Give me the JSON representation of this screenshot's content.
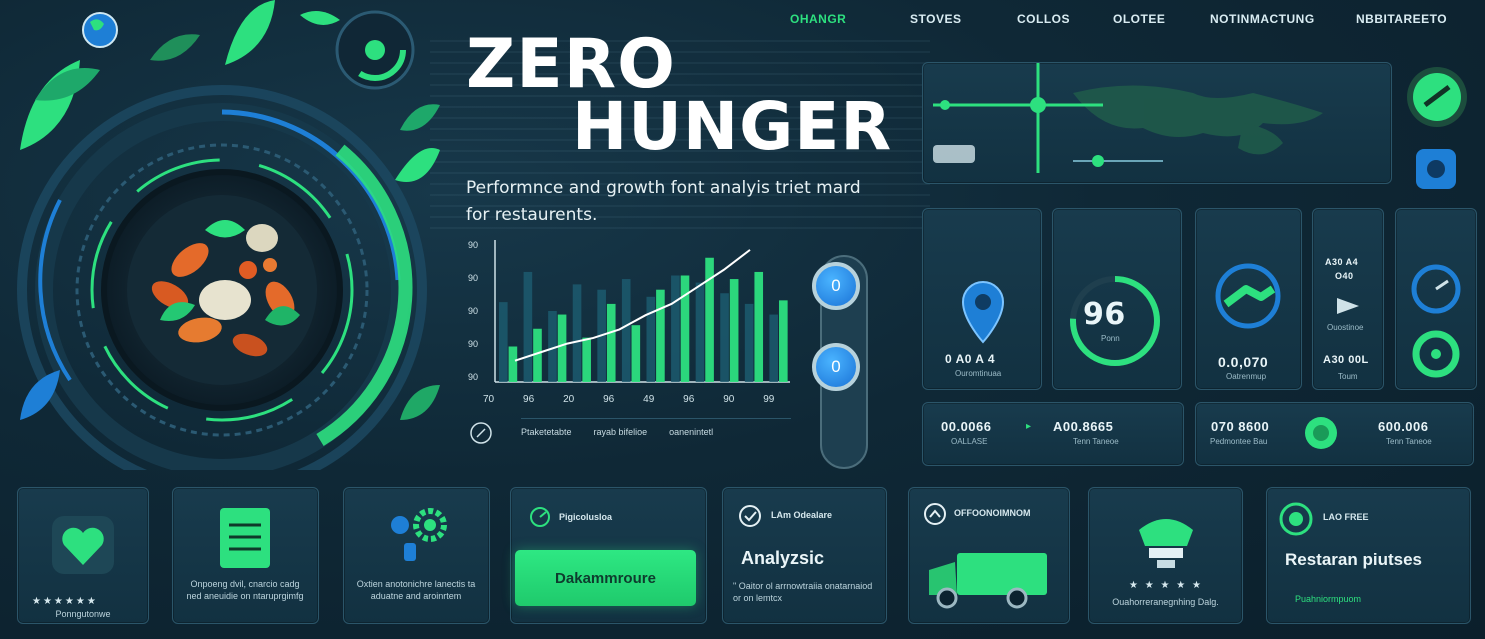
{
  "nav": {
    "items": [
      {
        "label": "OHANGR",
        "active": true
      },
      {
        "label": "STOVES",
        "active": false
      },
      {
        "label": "COLLOS",
        "active": false
      },
      {
        "label": "OLOTEE",
        "active": false
      },
      {
        "label": "NOTINMACTUNG",
        "active": false
      },
      {
        "label": "NBBITAREETO",
        "active": false
      }
    ]
  },
  "hero": {
    "title_line1": "ZERO",
    "title_line2": "HUNGER",
    "subtitle": "Performnce and growth font analyis triet mard for restaurents."
  },
  "chart_data": {
    "type": "bar",
    "y_ticks": [
      "90",
      "90",
      "90",
      "90",
      "90"
    ],
    "x_ticks": [
      "70",
      "96",
      "20",
      "96",
      "49",
      "96",
      "90",
      "99"
    ],
    "series": [
      {
        "values": [
          45,
          62,
          40,
          55,
          52,
          58,
          48,
          60,
          56,
          50,
          44,
          38
        ]
      },
      {
        "values": [
          20,
          30,
          38,
          25,
          44,
          32,
          52,
          60,
          70,
          58,
          62,
          46
        ]
      }
    ],
    "trend": [
      8,
      14,
      20,
      24,
      30,
      40,
      48,
      60,
      72,
      86
    ],
    "legend": [
      "Ptaketetabte",
      "rayab bifelioe",
      "oanenintetl"
    ]
  },
  "toggles": {
    "top_value": "0",
    "bottom_value": "0"
  },
  "kpi_tiles": [
    {
      "value": "0 A0 A 4",
      "label": "Ouromtinuaa"
    },
    {
      "value": "96",
      "label": "Ponn"
    },
    {
      "value": "0.0,070",
      "label": "Oatrenmup"
    },
    {
      "value_top": "A30 A4",
      "value_mid": "O40",
      "sub": "Ouostinoe",
      "value": "A30 00L",
      "label": "Toum"
    },
    {
      "value": "",
      "label": ""
    }
  ],
  "stats_left": [
    {
      "value": "00.0066",
      "label": "OALLASE"
    },
    {
      "value": "A00.8665",
      "label": "Tenn Taneoe"
    }
  ],
  "stats_right": [
    {
      "value": "070 8600",
      "label": "Pedmontee Bau"
    },
    {
      "value": "600.006",
      "label": "Tenn Taneoe"
    }
  ],
  "cards": [
    {
      "title": "",
      "body": "",
      "stars": "★★★★★★",
      "caption": "Ponngutonwe"
    },
    {
      "title": "",
      "body": "Onpoeng dvil, cnarcio cadg ned aneuidie on ntaruprgimfg",
      "stars": "",
      "caption": ""
    },
    {
      "title": "",
      "body": "Oxtien anotonichre lanectis ta aduatne and aroinrtem",
      "stars": "",
      "caption": ""
    },
    {
      "title": "Pigicolusloa",
      "button": "Dakammroure"
    },
    {
      "title": "LAm Odealare",
      "heading": "Analyzsic",
      "body": "\" Oaitor ol arrnowtraiia onatarnaiod or on lemtcx"
    },
    {
      "title": "OFFOONOIMNOM",
      "body": ""
    },
    {
      "title": "",
      "stars": "★ ★ ★ ★ ★",
      "caption": "Ouahorreranegnhing Dalg."
    },
    {
      "title": "LAO FREE",
      "heading": "Restaran piutses",
      "caption": "Puahniormpuom"
    }
  ]
}
